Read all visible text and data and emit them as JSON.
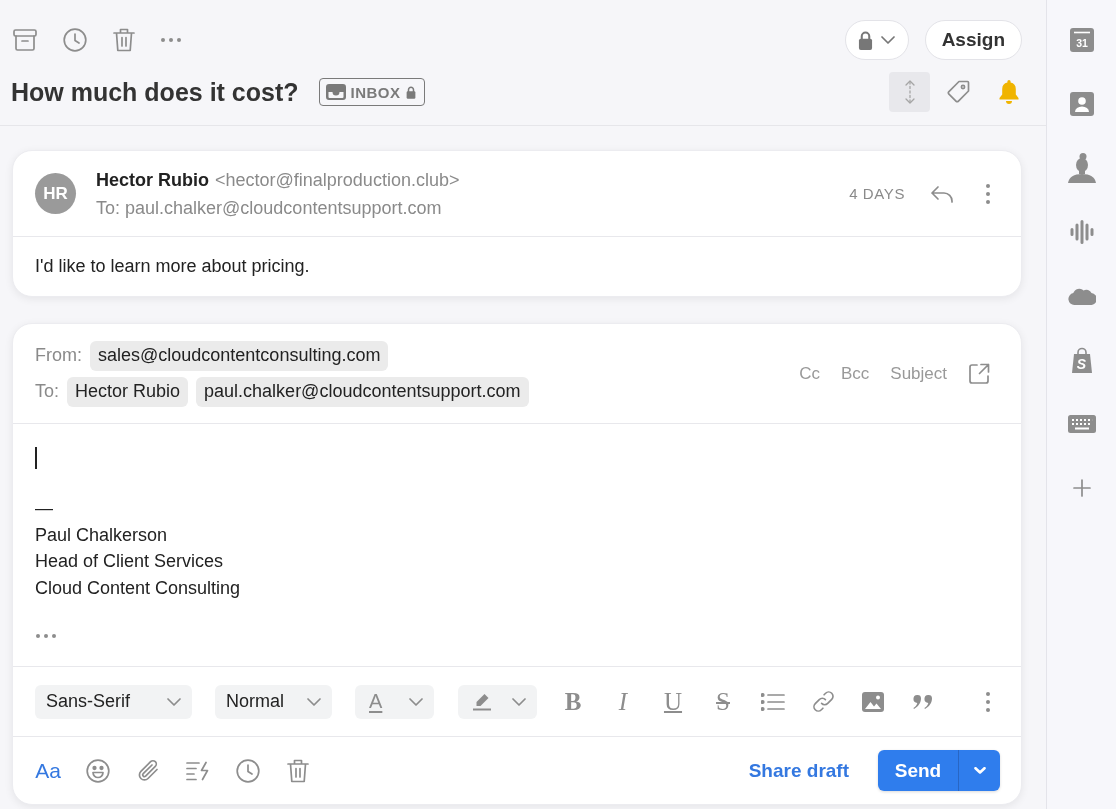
{
  "toolbar": {
    "actions": [
      {
        "kind": "archive"
      },
      {
        "kind": "snooze"
      },
      {
        "kind": "delete"
      },
      {
        "kind": "more"
      }
    ],
    "privacy_menu": {
      "kind": "lock"
    },
    "assign": "Assign"
  },
  "conversation": {
    "title": "How much does it cost?",
    "tag": {
      "label": "INBOX",
      "locked": true
    },
    "actions": [
      {
        "kind": "expand",
        "active": true
      },
      {
        "kind": "tag",
        "active": false
      },
      {
        "kind": "bell",
        "active": true
      }
    ]
  },
  "message": {
    "initials": "HR",
    "sender": "Hector Rubio",
    "sender_email": "<hector@finalproduction.club>",
    "recipient": "To: paul.chalker@cloudcontentsupport.com",
    "time": "4 DAYS",
    "body": "I'd like to learn more about pricing."
  },
  "composer": {
    "from_label": "From:",
    "from": [
      "sales@cloudcontentconsulting.com"
    ],
    "to_label": "To:",
    "to": [
      "Hector Rubio",
      "paul.chalker@cloudcontentsupport.com"
    ],
    "header_links": [
      "Cc",
      "Bcc",
      "Subject"
    ],
    "signature": [
      "—",
      "Paul Chalkerson",
      "Head of Client Services",
      "Cloud Content Consulting"
    ],
    "format_bar": {
      "font": "Sans-Serif",
      "size": "Normal",
      "text_color": "A",
      "buttons": [
        {
          "kind": "bold",
          "label": "B"
        },
        {
          "kind": "italic",
          "label": "I"
        },
        {
          "kind": "underline",
          "label": "U"
        },
        {
          "kind": "strike",
          "label": "S"
        },
        {
          "kind": "list"
        },
        {
          "kind": "link"
        },
        {
          "kind": "image"
        },
        {
          "kind": "quote"
        },
        {
          "kind": "more"
        }
      ]
    },
    "tools": [
      {
        "kind": "format",
        "label": "Aa",
        "active": true
      },
      {
        "kind": "emoji",
        "active": false
      },
      {
        "kind": "attach",
        "active": false
      },
      {
        "kind": "snippet",
        "active": false
      },
      {
        "kind": "schedule",
        "active": false
      },
      {
        "kind": "discard",
        "active": false
      }
    ],
    "share_draft": "Share draft",
    "send": "Send"
  },
  "sidebar": {
    "apps": [
      {
        "kind": "calendar",
        "label": "31"
      },
      {
        "kind": "contact"
      },
      {
        "kind": "person"
      },
      {
        "kind": "waveform"
      },
      {
        "kind": "cloud"
      },
      {
        "kind": "bag",
        "label": "S"
      },
      {
        "kind": "keyboard"
      },
      {
        "kind": "add"
      }
    ]
  }
}
